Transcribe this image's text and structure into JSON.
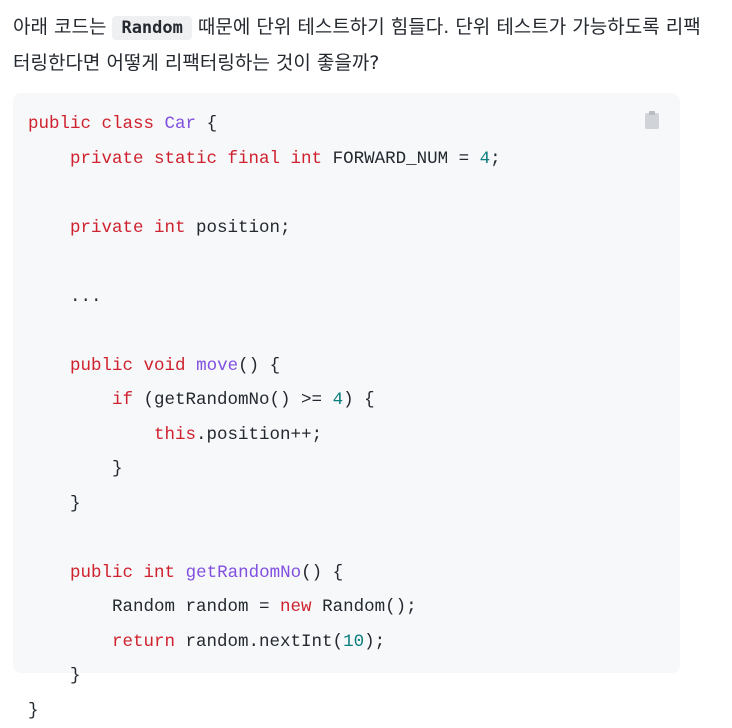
{
  "question": {
    "text_before": "아래 코드는",
    "code_term": "Random",
    "text_after": "때문에 단위 테스트하기 힘들다. 단위 테스트가 가능하도록 리팩터링한다면 어떻게 리팩터링하는 것이 좋을까?"
  },
  "code_block": {
    "copy_icon": "clipboard-icon",
    "lines": [
      [
        {
          "t": "kw",
          "v": "public class"
        },
        {
          "t": "p",
          "v": " "
        },
        {
          "t": "fn",
          "v": "Car"
        },
        {
          "t": "p",
          "v": " {"
        }
      ],
      [
        {
          "t": "p",
          "v": "    "
        },
        {
          "t": "kw",
          "v": "private static final int"
        },
        {
          "t": "p",
          "v": " FORWARD_NUM = "
        },
        {
          "t": "num",
          "v": "4"
        },
        {
          "t": "p",
          "v": ";"
        }
      ],
      [],
      [
        {
          "t": "p",
          "v": "    "
        },
        {
          "t": "kw",
          "v": "private int"
        },
        {
          "t": "p",
          "v": " position;"
        }
      ],
      [],
      [
        {
          "t": "p",
          "v": "    ..."
        }
      ],
      [],
      [
        {
          "t": "p",
          "v": "    "
        },
        {
          "t": "kw",
          "v": "public void"
        },
        {
          "t": "p",
          "v": " "
        },
        {
          "t": "fn",
          "v": "move"
        },
        {
          "t": "p",
          "v": "() {"
        }
      ],
      [
        {
          "t": "p",
          "v": "        "
        },
        {
          "t": "kw",
          "v": "if"
        },
        {
          "t": "p",
          "v": " (getRandomNo() >= "
        },
        {
          "t": "num",
          "v": "4"
        },
        {
          "t": "p",
          "v": ") {"
        }
      ],
      [
        {
          "t": "p",
          "v": "            "
        },
        {
          "t": "kw",
          "v": "this"
        },
        {
          "t": "p",
          "v": ".position++;"
        }
      ],
      [
        {
          "t": "p",
          "v": "        }"
        }
      ],
      [
        {
          "t": "p",
          "v": "    }"
        }
      ],
      [],
      [
        {
          "t": "p",
          "v": "    "
        },
        {
          "t": "kw",
          "v": "public int"
        },
        {
          "t": "p",
          "v": " "
        },
        {
          "t": "fn",
          "v": "getRandomNo"
        },
        {
          "t": "p",
          "v": "() {"
        }
      ],
      [
        {
          "t": "p",
          "v": "        Random random = "
        },
        {
          "t": "kw",
          "v": "new"
        },
        {
          "t": "p",
          "v": " Random();"
        }
      ],
      [
        {
          "t": "p",
          "v": "        "
        },
        {
          "t": "kw",
          "v": "return"
        },
        {
          "t": "p",
          "v": " random.nextInt("
        },
        {
          "t": "num",
          "v": "10"
        },
        {
          "t": "p",
          "v": ");"
        }
      ],
      [
        {
          "t": "p",
          "v": "    }"
        }
      ],
      [
        {
          "t": "p",
          "v": "}"
        }
      ]
    ]
  }
}
